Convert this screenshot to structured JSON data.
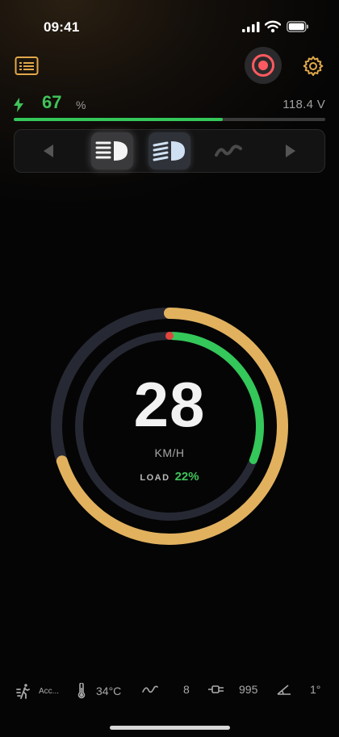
{
  "status_bar": {
    "time": "09:41"
  },
  "toolbar": {
    "log_icon": "log-list-icon",
    "record_icon": "record-icon",
    "settings_icon": "gear-icon",
    "accent": "#e1a84a",
    "record_color": "#ff5a5f"
  },
  "battery": {
    "percent": "67",
    "unit": "%",
    "voltage": "118.4 V",
    "level": 0.67,
    "color": "#34c759"
  },
  "mode_bar": {
    "items": [
      {
        "icon": "chevron-left-icon"
      },
      {
        "icon": "high-beam-icon",
        "active": true
      },
      {
        "icon": "low-beam-icon",
        "active": true
      },
      {
        "icon": "road-wave-icon",
        "active": false
      },
      {
        "icon": "chevron-right-icon"
      }
    ]
  },
  "gauge": {
    "speed": "28",
    "unit": "KM/H",
    "load_label": "LOAD",
    "load_value": "22%",
    "outer_ring_color": "#e1b15e",
    "inner_ring_color": "#34c759",
    "track_color": "#262833"
  },
  "bottom_bar": {
    "mode_label": "Acc...",
    "temperature": "34°C",
    "waves": "8",
    "power": "995",
    "angle": "1°"
  }
}
